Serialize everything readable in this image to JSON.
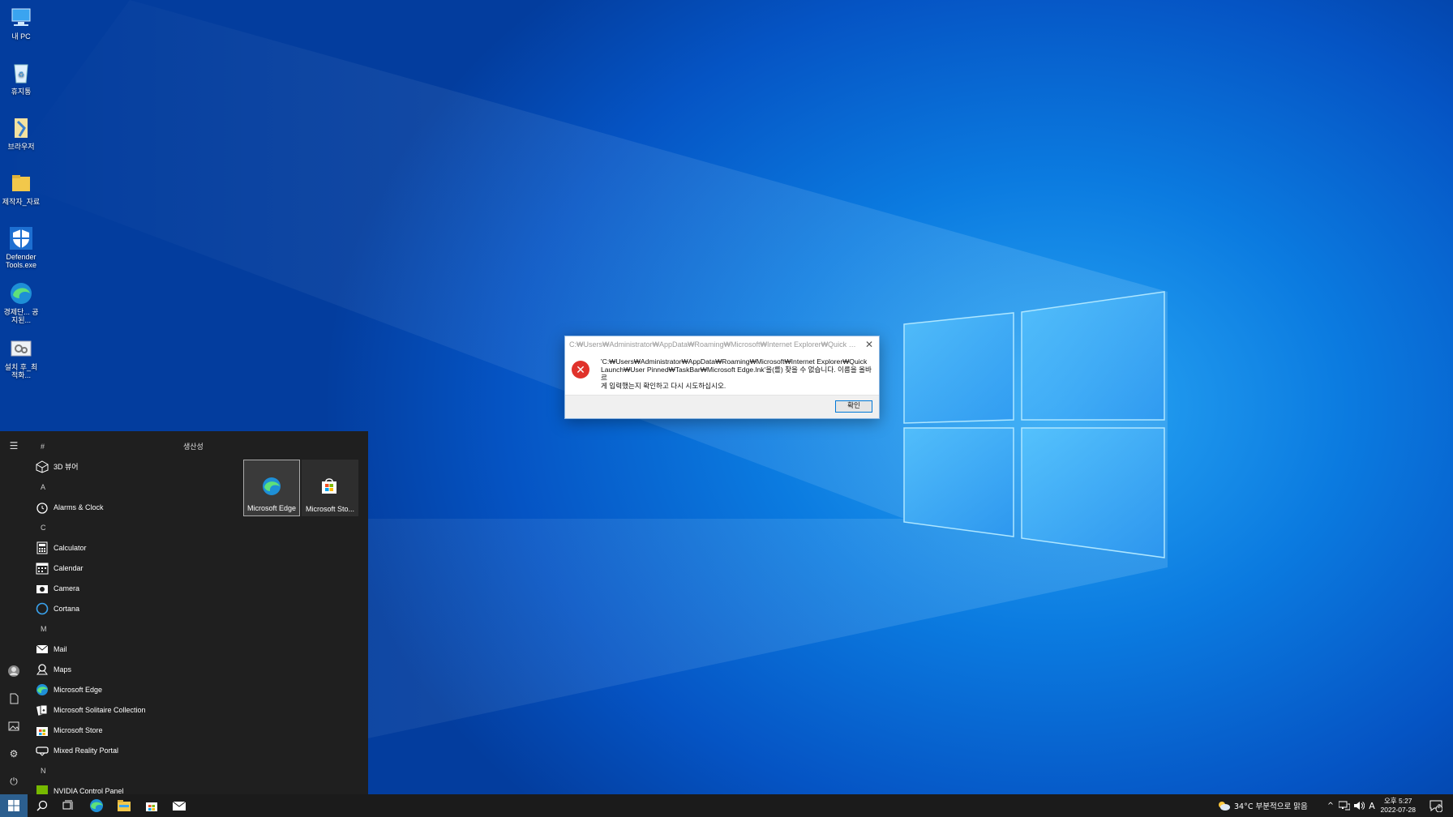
{
  "desktop": {
    "icons": [
      {
        "label": "내 PC",
        "icon": "computer-icon"
      },
      {
        "label": "휴지통",
        "icon": "recycle-bin-icon"
      },
      {
        "label": "브라우저",
        "icon": "browser-shortcut-icon"
      },
      {
        "label": "제작자_자료",
        "icon": "folder-icon"
      },
      {
        "label": "Defender Tools.exe",
        "icon": "defender-shield-icon"
      },
      {
        "label": "경제단... 공지된...",
        "icon": "edge-icon"
      },
      {
        "label": "설치 후_최적화...",
        "icon": "settings-shortcut-icon"
      }
    ]
  },
  "dialog": {
    "title": "C:₩Users₩Administrator₩AppData₩Roaming₩Microsoft₩Internet Explorer₩Quick Launch₩Us...",
    "message_line1": "'C:₩Users₩Administrator₩AppData₩Roaming₩Microsoft₩Internet Explorer₩Quick",
    "message_line2": "Launch₩User Pinned₩TaskBar₩Microsoft Edge.lnk'을(를) 찾을 수 없습니다. 이름을 올바르",
    "message_line3": "게 입력했는지 확인하고 다시 시도하십시오.",
    "ok_label": "확인",
    "close_glyph": "✕",
    "icon": "error-icon"
  },
  "start_menu": {
    "tiles_header": "생산성",
    "tiles": [
      {
        "label": "Microsoft Edge",
        "icon": "edge-icon"
      },
      {
        "label": "Microsoft Sto...",
        "icon": "store-icon"
      }
    ],
    "list": [
      {
        "type": "letter",
        "text": "#"
      },
      {
        "type": "app",
        "text": "3D 뷰어",
        "icon": "cube-icon"
      },
      {
        "type": "letter",
        "text": "A"
      },
      {
        "type": "app",
        "text": "Alarms & Clock",
        "icon": "alarm-clock-icon"
      },
      {
        "type": "letter",
        "text": "C"
      },
      {
        "type": "app",
        "text": "Calculator",
        "icon": "calculator-icon"
      },
      {
        "type": "app",
        "text": "Calendar",
        "icon": "calendar-icon"
      },
      {
        "type": "app",
        "text": "Camera",
        "icon": "camera-icon"
      },
      {
        "type": "app",
        "text": "Cortana",
        "icon": "cortana-icon"
      },
      {
        "type": "letter",
        "text": "M"
      },
      {
        "type": "app",
        "text": "Mail",
        "icon": "mail-icon"
      },
      {
        "type": "app",
        "text": "Maps",
        "icon": "maps-icon"
      },
      {
        "type": "app",
        "text": "Microsoft Edge",
        "icon": "edge-icon"
      },
      {
        "type": "app",
        "text": "Microsoft Solitaire Collection",
        "icon": "cards-icon"
      },
      {
        "type": "app",
        "text": "Microsoft Store",
        "icon": "store-icon"
      },
      {
        "type": "app",
        "text": "Mixed Reality Portal",
        "icon": "vr-headset-icon"
      },
      {
        "type": "letter",
        "text": "N"
      },
      {
        "type": "app",
        "text": "NVIDIA Control Panel",
        "icon": "nvidia-icon"
      }
    ]
  },
  "taskbar": {
    "weather": "34°C  부분적으로 맑음",
    "ime": "A",
    "time": "오후 5:27",
    "date": "2022-07-28",
    "notification_count": "2",
    "tray_chevron": "^"
  }
}
